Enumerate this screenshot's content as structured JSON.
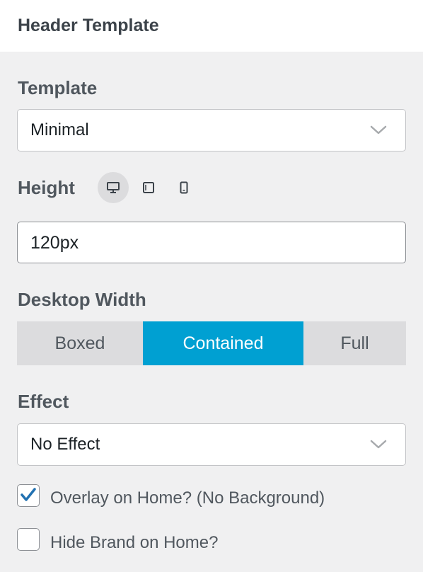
{
  "header": {
    "title": "Header Template"
  },
  "template": {
    "label": "Template",
    "value": "Minimal"
  },
  "height": {
    "label": "Height",
    "devices": [
      {
        "name": "desktop",
        "icon": "desktop-icon",
        "active": true
      },
      {
        "name": "tablet",
        "icon": "tablet-icon",
        "active": false
      },
      {
        "name": "mobile",
        "icon": "mobile-icon",
        "active": false
      }
    ],
    "value": "120px"
  },
  "desktop_width": {
    "label": "Desktop Width",
    "options": [
      "Boxed",
      "Contained",
      "Full"
    ],
    "selected": "Contained"
  },
  "effect": {
    "label": "Effect",
    "value": "No Effect"
  },
  "checkboxes": [
    {
      "label": "Overlay on Home? (No Background)",
      "checked": true
    },
    {
      "label": "Hide Brand on Home?",
      "checked": false
    }
  ],
  "colors": {
    "accent": "#00a0d2",
    "check": "#2271b1"
  }
}
